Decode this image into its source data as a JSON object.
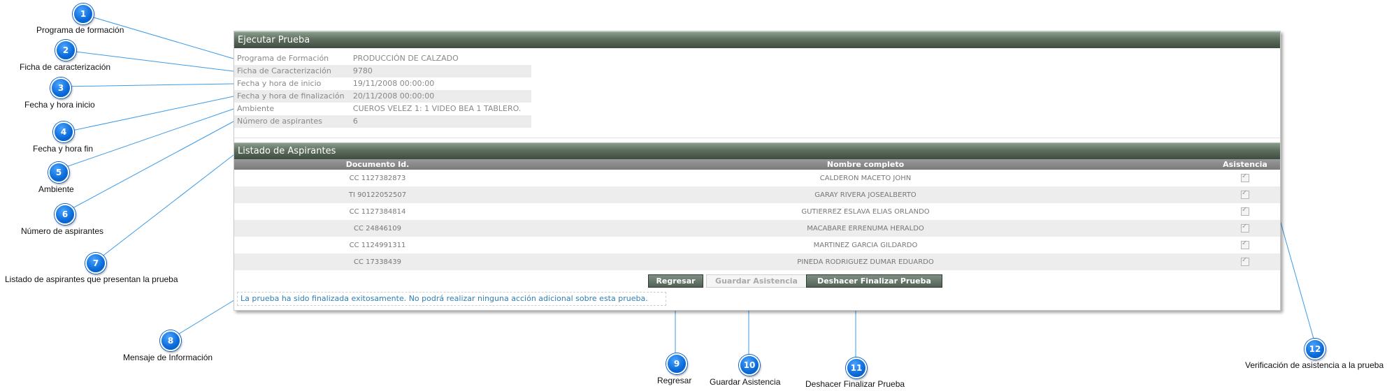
{
  "panel": {
    "title": "Ejecutar Prueba",
    "fields": [
      {
        "label": "Programa de Formación",
        "value": "PRODUCCIÓN DE CALZADO"
      },
      {
        "label": "Ficha de Caracterización",
        "value": "9780"
      },
      {
        "label": "Fecha y hora de inicio",
        "value": "19/11/2008 00:00:00"
      },
      {
        "label": "Fecha y hora de finalización",
        "value": "20/11/2008 00:00:00"
      },
      {
        "label": "Ambiente",
        "value": "CUEROS VELEZ 1: 1 VIDEO BEA 1 TABLERO."
      },
      {
        "label": "Número de aspirantes",
        "value": "6"
      }
    ]
  },
  "aspirantes": {
    "title": "Listado de Aspirantes",
    "columns": [
      "Documento Id.",
      "Nombre completo",
      "Asistencia"
    ],
    "rows": [
      {
        "doc": "CC 1127382873",
        "name": "CALDERON MACETO JOHN",
        "asistencia": true
      },
      {
        "doc": "TI 90122052507",
        "name": "GARAY RIVERA JOSEALBERTO",
        "asistencia": true
      },
      {
        "doc": "CC 1127384814",
        "name": "GUTIERREZ ESLAVA ELIAS ORLANDO",
        "asistencia": true
      },
      {
        "doc": "CC 24846109",
        "name": "MACABARE ERRENUMA HERALDO",
        "asistencia": true
      },
      {
        "doc": "CC 1124991311",
        "name": "MARTINEZ GARCIA GILDARDO",
        "asistencia": true
      },
      {
        "doc": "CC 17338439",
        "name": "PINEDA RODRIGUEZ DUMAR EDUARDO",
        "asistencia": true
      }
    ]
  },
  "buttons": {
    "regresar": "Regresar",
    "guardar": "Guardar Asistencia",
    "deshacer": "Deshacer Finalizar Prueba"
  },
  "message": "La prueba ha sido finalizada exitosamente. No podrá realizar ninguna acción adicional sobre esta prueba.",
  "callouts": [
    {
      "num": "1",
      "label": "Programa de formación"
    },
    {
      "num": "2",
      "label": "Ficha de caracterización"
    },
    {
      "num": "3",
      "label": "Fecha y hora inicio"
    },
    {
      "num": "4",
      "label": "Fecha y hora fin"
    },
    {
      "num": "5",
      "label": "Ambiente"
    },
    {
      "num": "6",
      "label": "Número de aspirantes"
    },
    {
      "num": "7",
      "label": "Listado de aspirantes que presentan la prueba"
    },
    {
      "num": "8",
      "label": "Mensaje de Información"
    },
    {
      "num": "9",
      "label": "Regresar"
    },
    {
      "num": "10",
      "label": "Guardar Asistencia"
    },
    {
      "num": "11",
      "label": "Deshacer Finalizar Prueba"
    },
    {
      "num": "12",
      "label": "Verificación de asistencia a la prueba"
    }
  ],
  "colors": {
    "callout": "#0a6ad9",
    "header": "#4f5f52",
    "message": "#2f7fb8"
  }
}
